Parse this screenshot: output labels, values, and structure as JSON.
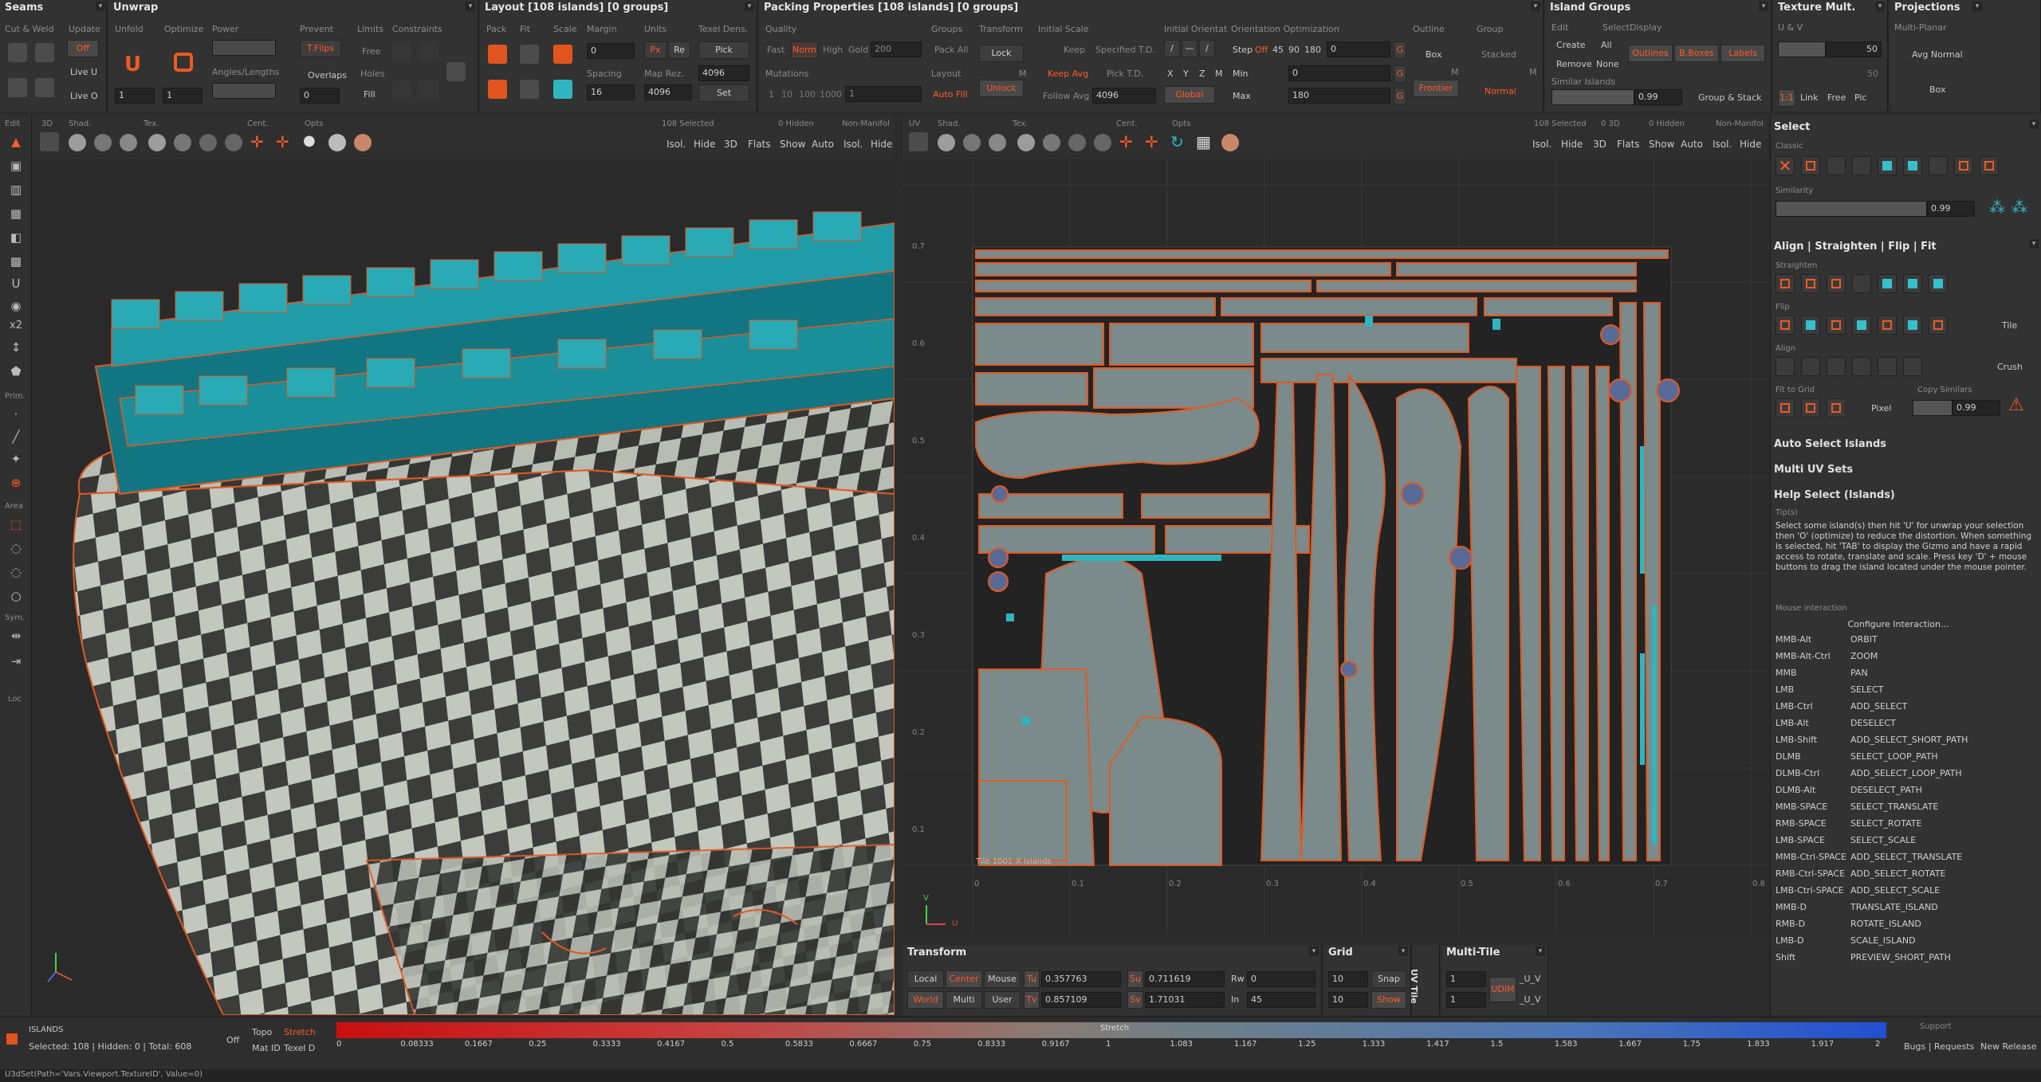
{
  "colors": {
    "accent": "#ff5a2a",
    "cyan": "#2fb5c0",
    "panel": "#323232",
    "viewport": "#2a2a2a"
  },
  "seams": {
    "title": "Seams",
    "cut_weld": "Cut & Weld",
    "update": "Update",
    "off": "Off",
    "live_u": "Live U",
    "live_o": "Live O"
  },
  "unwrap": {
    "title": "Unwrap",
    "unfold": "Unfold",
    "optimize": "Optimize",
    "power": "Power",
    "prevent": "Prevent",
    "limits": "Limits",
    "constraints": "Constraints",
    "tflips": "T.Flips",
    "free": "Free",
    "overlaps": "Overlaps",
    "angles_lengths": "Angles/Lengths",
    "holes": "Holes",
    "fill": "Fill",
    "v1": "1",
    "v2": "1",
    "v3": "0"
  },
  "layout": {
    "title": "Layout [108 islands] [0 groups]",
    "pack": "Pack",
    "fit": "Fit",
    "scale": "Scale",
    "margin": "Margin",
    "margin_val": "0",
    "spacing": "Spacing",
    "spacing_val": "16",
    "units": "Units",
    "px": "Px",
    "re": "Re",
    "texel": "Texel Dens.",
    "pick": "Pick",
    "maprez": "Map Rez.",
    "tex1": "4096",
    "tex2": "4096",
    "set": "Set"
  },
  "packing": {
    "title": "Packing Properties [108 islands] [0 groups]",
    "quality": "Quality",
    "fast": "Fast",
    "norm": "Norm",
    "high": "High",
    "gold": "Gold",
    "gold_val": "200",
    "mutations": "Mutations",
    "m1": "1",
    "m10": "10",
    "m100": "100",
    "m1000": "1000",
    "m1b": "1",
    "groups": "Groups",
    "pack_all": "Pack All",
    "layout": "Layout",
    "auto_fill": "Auto Fill",
    "transform": "Transform",
    "lock": "Lock",
    "unlock": "Unlock",
    "initial_scale": "Initial Scale",
    "keep": "Keep",
    "keep_avg": "Keep Avg",
    "specified": "Specified T.D.",
    "pick_td": "Pick T.D.",
    "follow_avg": "Follow Avg",
    "follow_val": "4096",
    "initial_orient": "Initial Orientat",
    "x": "X",
    "y": "Y",
    "z": "Z",
    "global": "Global",
    "orient_opt": "Orientation Optimization",
    "step": "Step",
    "off": "Off",
    "a45": "45",
    "a90": "90",
    "a180": "180",
    "step_val": "0",
    "min": "Min",
    "min_val": "0",
    "max": "Max",
    "max_val": "180",
    "outline": "Outline",
    "box": "Box",
    "frontier": "Frontier",
    "group": "Group",
    "stacked": "Stacked",
    "normal": "Normal",
    "g": "G",
    "m": "M"
  },
  "island_groups": {
    "title": "Island Groups",
    "edit": "Edit",
    "select": "Select",
    "display": "Display",
    "create": "Create",
    "all": "All",
    "remove": "Remove",
    "none": "None",
    "outlines": "Outlines",
    "bboxes": "B.Boxes",
    "labels": "Labels",
    "similar": "Similar Islands",
    "sim_val": "0.99",
    "group_stack": "Group & Stack"
  },
  "texture_mult": {
    "title": "Texture Mult.",
    "uv": "U & V",
    "v50a": "50",
    "v50b": "50",
    "r11": "1:1",
    "link": "Link",
    "free": "Free",
    "pic": "Pic"
  },
  "projections": {
    "title": "Projections",
    "multiplanar": "Multi-Planar",
    "avg_normal": "Avg Normal",
    "box": "Box"
  },
  "vp3d": {
    "label": "3D",
    "shad": "Shad.",
    "tex": "Tex.",
    "cent": "Cent.",
    "opts": "Opts",
    "selected": "108 Selected",
    "hidden": "0 Hidden",
    "nonmanifold": "Non-Manifol",
    "isol": "Isol.",
    "hide": "Hide",
    "v3d": "3D",
    "flats": "Flats",
    "show": "Show",
    "auto": "Auto"
  },
  "vpuv": {
    "label": "UV",
    "shad": "Shad.",
    "tex": "Tex.",
    "cent": "Cent.",
    "opts": "Opts",
    "selected": "108 Selected",
    "hidden": "0 3D",
    "hidden2": "0 Hidden",
    "nonmanifold": "Non-Manifol",
    "isol": "Isol.",
    "hide": "Hide",
    "v3d": "3D",
    "flats": "Flats",
    "show": "Show",
    "auto": "Auto",
    "tile": "Tile 1001",
    "islands": "X   islands"
  },
  "uv_axis": {
    "x": [
      "0",
      "0.1",
      "0.2",
      "0.3",
      "0.4",
      "0.5",
      "0.6",
      "0.7",
      "0.8"
    ],
    "y": [
      "0.7",
      "0.6",
      "0.5",
      "0.4",
      "0.3",
      "0.2",
      "0.1"
    ],
    "u": "U",
    "v": "V"
  },
  "left_tools": {
    "edit": "Edit",
    "prim": "Prim.",
    "area": "Area",
    "sym": "Sym.",
    "loc": "Loc",
    "x2": "x2"
  },
  "select_panel": {
    "title": "Select",
    "classic": "Classic",
    "similarity": "Similarity",
    "sim_val": "0.99"
  },
  "align_panel": {
    "title": "Align | Straighten | Flip | Fit",
    "straighten": "Straighten",
    "flip": "Flip",
    "tile": "Tile",
    "align": "Align",
    "crush": "Crush",
    "fit_grid": "Fit to Grid",
    "copy_similars": "Copy Similars",
    "pixel": "Pixel",
    "cs_val": "0.99"
  },
  "sections": {
    "auto_select": "Auto Select Islands",
    "multi_uv": "Multi UV Sets",
    "help": "Help Select (Islands)",
    "tips": "Tip(s)",
    "tips_text": "Select some island(s) then hit 'U' for unwrap your selection then 'O' (optimize) to reduce the distortion. When something is selected, hit 'TAB' to display the Gizmo and have a rapid access to rotate, translate and scale. Press key 'D' + mouse buttons to drag the island located under the mouse pointer.",
    "mouse_int": "Mouse interaction",
    "configure": "Configure Interaction..."
  },
  "bindings": [
    {
      "k": "MMB-Alt",
      "v": "ORBIT"
    },
    {
      "k": "MMB-Alt-Ctrl",
      "v": "ZOOM"
    },
    {
      "k": "MMB",
      "v": "PAN"
    },
    {
      "k": "LMB",
      "v": "SELECT"
    },
    {
      "k": "LMB-Ctrl",
      "v": "ADD_SELECT"
    },
    {
      "k": "LMB-Alt",
      "v": "DESELECT"
    },
    {
      "k": "LMB-Shift",
      "v": "ADD_SELECT_SHORT_PATH"
    },
    {
      "k": "DLMB",
      "v": "SELECT_LOOP_PATH"
    },
    {
      "k": "DLMB-Ctrl",
      "v": "ADD_SELECT_LOOP_PATH"
    },
    {
      "k": "DLMB-Alt",
      "v": "DESELECT_PATH"
    },
    {
      "k": "MMB-SPACE",
      "v": "SELECT_TRANSLATE"
    },
    {
      "k": "RMB-SPACE",
      "v": "SELECT_ROTATE"
    },
    {
      "k": "LMB-SPACE",
      "v": "SELECT_SCALE"
    },
    {
      "k": "MMB-Ctrl-SPACE",
      "v": "ADD_SELECT_TRANSLATE"
    },
    {
      "k": "RMB-Ctrl-SPACE",
      "v": "ADD_SELECT_ROTATE"
    },
    {
      "k": "LMB-Ctrl-SPACE",
      "v": "ADD_SELECT_SCALE"
    },
    {
      "k": "MMB-D",
      "v": "TRANSLATE_ISLAND"
    },
    {
      "k": "RMB-D",
      "v": "ROTATE_ISLAND"
    },
    {
      "k": "LMB-D",
      "v": "SCALE_ISLAND"
    },
    {
      "k": "Shift",
      "v": "PREVIEW_SHORT_PATH"
    }
  ],
  "transform": {
    "title": "Transform",
    "local": "Local",
    "center": "Center",
    "mouse": "Mouse",
    "world": "World",
    "multi": "Multi",
    "user": "User",
    "tu": "Tu",
    "tu_val": "0.357763",
    "tv": "Tv",
    "tv_val": "0.857109",
    "su": "Su",
    "su_val": "0.711619",
    "sv": "Sv",
    "sv_val": "1.71031",
    "rw": "Rw",
    "rw_val": "0",
    "in": "In",
    "in_val": "45"
  },
  "grid": {
    "title": "Grid",
    "v1": "10",
    "v2": "10",
    "snap": "Snap",
    "show": "Show"
  },
  "uvtile": {
    "title": "UV Tile"
  },
  "multitile": {
    "title": "Multi-Tile",
    "v1": "1",
    "v2": "1",
    "udim": "UDIM",
    "u": "_U_V",
    "v": "_U_V"
  },
  "status": {
    "islands": "ISLANDS",
    "counts": "Selected: 108 | Hidden: 0 | Total: 608",
    "off": "Off",
    "topo": "Topo",
    "stretch_btn": "Stretch",
    "mat_id": "Mat ID",
    "texel_d": "Texel D",
    "stretch_label": "Stretch",
    "support": "Support",
    "bugs": "Bugs | Requests",
    "new_release": "New Release"
  },
  "scale_ticks": [
    "0",
    "0.08333",
    "0.1667",
    "0.25",
    "0.3333",
    "0.4167",
    "0.5",
    "0.5833",
    "0.6667",
    "0.75",
    "0.8333",
    "0.9167",
    "1",
    "1.083",
    "1.167",
    "1.25",
    "1.333",
    "1.417",
    "1.5",
    "1.583",
    "1.667",
    "1.75",
    "1.833",
    "1.917",
    "2"
  ],
  "console": "U3dSet(Path='Vars.Viewport.TextureID', Value=0)"
}
